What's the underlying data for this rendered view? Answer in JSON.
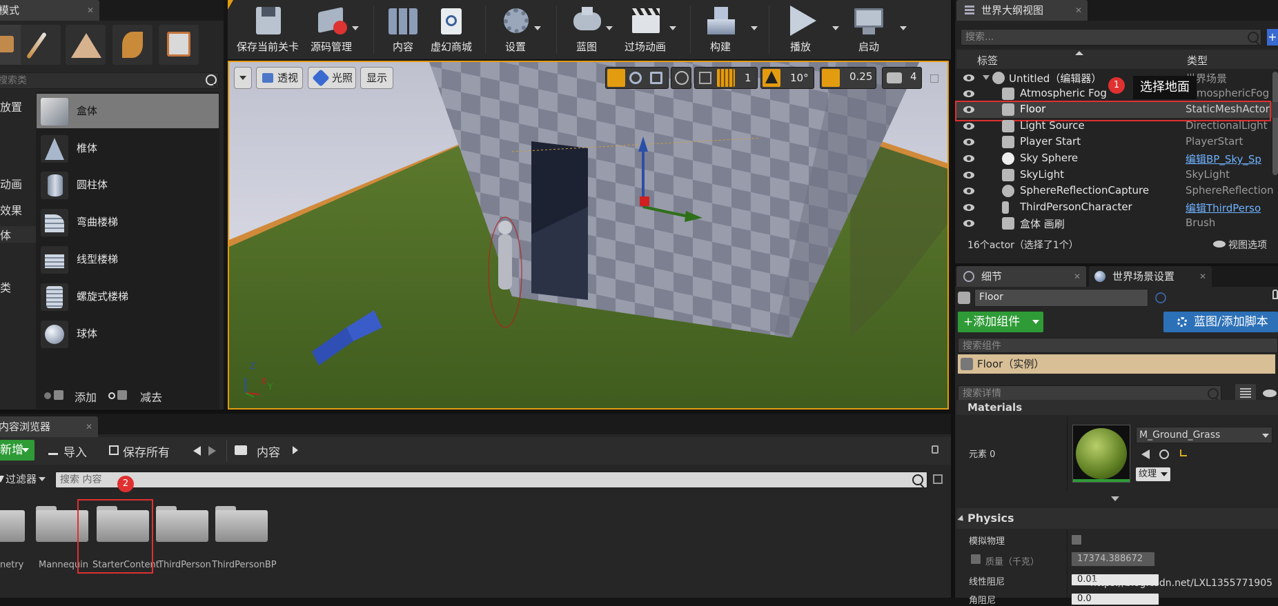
{
  "modes": {
    "tab_label": "模式",
    "search_placeholder": "搜索类",
    "categories": [
      "放置",
      "动画",
      "效果",
      "体",
      "类"
    ],
    "items": [
      {
        "label": "盒体",
        "icon": "box-icon"
      },
      {
        "label": "椎体",
        "icon": "cone-icon"
      },
      {
        "label": "圆柱体",
        "icon": "cylinder-icon"
      },
      {
        "label": "弯曲楼梯",
        "icon": "curved-stairs-icon"
      },
      {
        "label": "线型楼梯",
        "icon": "linear-stairs-icon"
      },
      {
        "label": "螺旋式楼梯",
        "icon": "spiral-stairs-icon"
      },
      {
        "label": "球体",
        "icon": "sphere-icon"
      }
    ],
    "add_label": "添加",
    "subtract_label": "减去"
  },
  "toolbar": {
    "buttons": [
      {
        "label": "保存当前关卡",
        "icon": "save-icon"
      },
      {
        "label": "源码管理",
        "icon": "source-control-icon"
      },
      {
        "label": "内容",
        "icon": "content-icon"
      },
      {
        "label": "虚幻商城",
        "icon": "marketplace-icon"
      },
      {
        "label": "设置",
        "icon": "settings-icon"
      },
      {
        "label": "蓝图",
        "icon": "blueprint-icon"
      },
      {
        "label": "过场动画",
        "icon": "cinematics-icon"
      },
      {
        "label": "构建",
        "icon": "build-icon"
      },
      {
        "label": "播放",
        "icon": "play-icon"
      },
      {
        "label": "启动",
        "icon": "launch-icon"
      }
    ]
  },
  "viewport": {
    "perspective_label": "透视",
    "lit_label": "光照",
    "show_label": "显示",
    "grid_snap": "1",
    "rotation_snap": "10°",
    "scale_snap": "0.25",
    "camera_speed": "4",
    "axis_labels": {
      "z": "Z",
      "x": "X",
      "y": "Y"
    }
  },
  "outliner": {
    "tab_label": "世界大纲视图",
    "search_placeholder": "搜索...",
    "col_label": "标签",
    "col_type": "类型",
    "rows": [
      {
        "name": "Untitled（编辑器）",
        "type": "世界场景",
        "icon": "world-icon"
      },
      {
        "name": "Atmospheric Fog",
        "type": "AtmosphericFog",
        "icon": "fog-icon"
      },
      {
        "name": "Floor",
        "type": "StaticMeshActor",
        "icon": "static-mesh-icon"
      },
      {
        "name": "Light Source",
        "type": "DirectionalLight",
        "icon": "directional-light-icon"
      },
      {
        "name": "Player Start",
        "type": "PlayerStart",
        "icon": "player-start-icon"
      },
      {
        "name": "Sky Sphere",
        "type": "编辑BP_Sky_Sp",
        "icon": "sphere-icon"
      },
      {
        "name": "SkyLight",
        "type": "SkyLight",
        "icon": "skylight-icon"
      },
      {
        "name": "SphereReflectionCapture",
        "type": "SphereReflection",
        "icon": "reflection-icon"
      },
      {
        "name": "ThirdPersonCharacter",
        "type": "编辑ThirdPerso",
        "icon": "character-icon"
      },
      {
        "name": "盒体 画刷",
        "type": "Brush",
        "icon": "brush-icon"
      }
    ],
    "status": "16个actor（选择了1个）",
    "view_options": "视图选项"
  },
  "annotations": {
    "marker1": "1",
    "marker1_text": "选择地面",
    "marker2": "2"
  },
  "details": {
    "tab_label": "细节",
    "world_settings_tab": "世界场景设置",
    "actor_name": "Floor",
    "add_component": "+添加组件",
    "blueprint_script": "蓝图/添加脚本",
    "search_components": "搜索组件",
    "component_instance": "Floor（实例）",
    "search_details": "搜索详情",
    "materials_header": "Materials",
    "element_label": "元素 0",
    "material_name": "M_Ground_Grass",
    "texture_dropdown": "纹理",
    "physics_header": "Physics",
    "simulate_physics": "模拟物理",
    "mass_label": "质量（千克）",
    "mass_value": "17374.388672",
    "linear_damping": "线性阻尼",
    "linear_damping_value": "0.01",
    "angular_damping": "角阻尼",
    "angular_damping_value": "0.0"
  },
  "content_browser": {
    "tab_label": "内容浏览器",
    "add_new": "新增",
    "import": "导入",
    "save_all": "保存所有",
    "path_root": "内容",
    "filters": "过滤器",
    "search_placeholder": "搜索 内容",
    "folders": [
      "Geometry",
      "Mannequin",
      "StarterContent",
      "ThirdPerson",
      "ThirdPersonBP"
    ],
    "folder_labels_visible": [
      "netry",
      "Mannequin",
      "StarterContent",
      "ThirdPerson",
      "ThirdPersonBP"
    ]
  },
  "watermark": "https://blog.csdn.net/LXL1355771905",
  "colors": {
    "accent_orange": "#e39b10",
    "highlight_red": "#e03030",
    "link_blue": "#6fb2ff",
    "green_button": "#2e9b36",
    "blue_button": "#2c70b7"
  }
}
